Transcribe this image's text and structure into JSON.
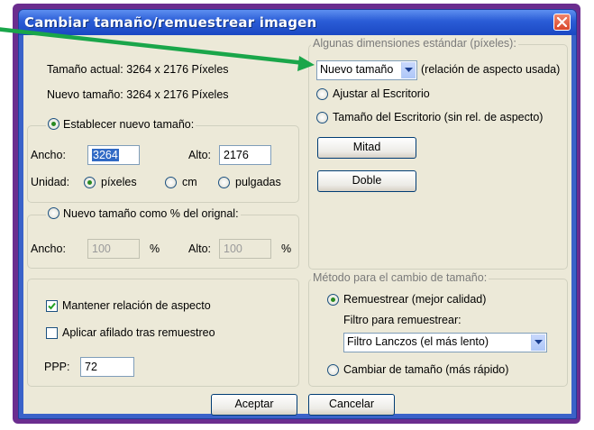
{
  "window": {
    "title": "Cambiar tamaño/remuestrear imagen"
  },
  "info": {
    "current_size": "Tamaño actual:  3264  x  2176  Píxeles",
    "new_size": "Nuevo tamaño:  3264  x  2176  Píxeles"
  },
  "set_size": {
    "label": "Establecer nuevo tamaño:",
    "width_label": "Ancho:",
    "width_value": "3264",
    "height_label": "Alto:",
    "height_value": "2176",
    "unit_label": "Unidad:",
    "units": [
      "píxeles",
      "cm",
      "pulgadas"
    ],
    "selected_unit": "píxeles"
  },
  "percent_size": {
    "label": "Nuevo tamaño como % del orignal:",
    "width_label": "Ancho:",
    "width_value": "100",
    "height_label": "Alto:",
    "height_value": "100",
    "percent_symbol": "%"
  },
  "options": {
    "keep_aspect": "Mantener relación de aspecto",
    "keep_aspect_checked": true,
    "apply_sharpen": "Aplicar afilado tras remuestreo",
    "apply_sharpen_checked": false,
    "ppp_label": "PPP:",
    "ppp_value": "72"
  },
  "standard": {
    "legend": "Algunas dimensiones estándar (píxeles):",
    "dropdown_value": "Nuevo tamaño",
    "aspect_note": "(relación de aspecto usada)",
    "fit_desktop": "Ajustar al Escritorio",
    "desktop_size": "Tamaño del Escritorio (sin rel. de aspecto)",
    "half_button": "Mitad",
    "double_button": "Doble"
  },
  "method": {
    "legend": "Método para el cambio de tamaño:",
    "resample": "Remuestrear (mejor calidad)",
    "filter_label": "Filtro para remuestrear:",
    "filter_value": "Filtro Lanczos (el más lento)",
    "resize": "Cambiar de tamaño (más rápido)"
  },
  "footer": {
    "ok": "Aceptar",
    "cancel": "Cancelar"
  },
  "colors": {
    "annotation_arrow": "#1aa64a",
    "frame": "#6b2d8f",
    "titlebar": "#2a5cd6"
  }
}
